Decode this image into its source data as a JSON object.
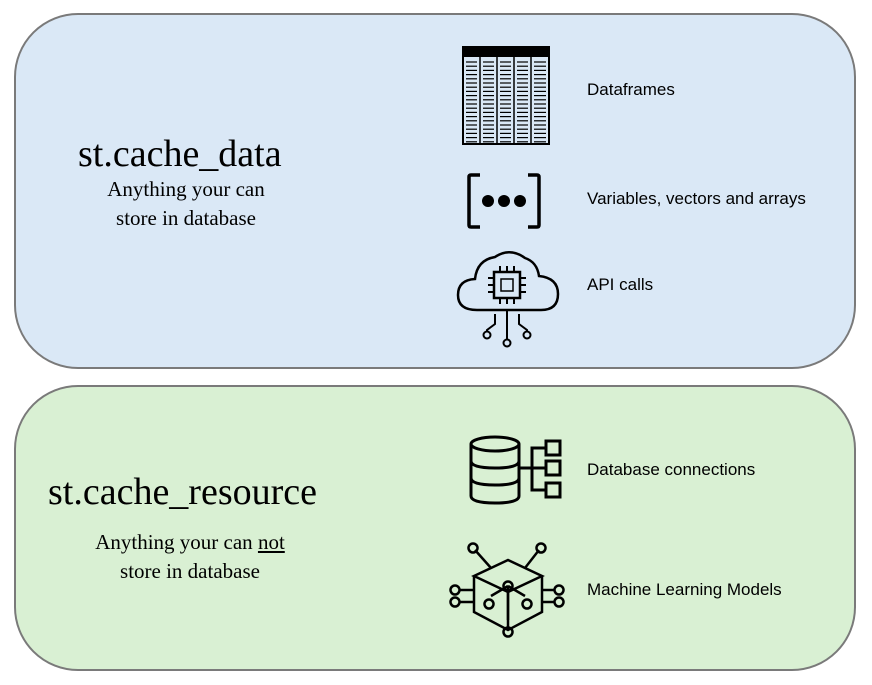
{
  "data_panel": {
    "title": "st.cache_data",
    "subtitle_line1": "Anything your can",
    "subtitle_line2": "store in database",
    "items": [
      {
        "label": "Dataframes",
        "icon": "table-icon"
      },
      {
        "label": "Variables, vectors and arrays",
        "icon": "brackets-dots-icon"
      },
      {
        "label": "API calls",
        "icon": "cloud-chip-icon"
      }
    ],
    "color": "#dae8f6"
  },
  "resource_panel": {
    "title": "st.cache_resource",
    "subtitle_pre": "Anything your can ",
    "subtitle_not": "not",
    "subtitle_line2": "store in database",
    "items": [
      {
        "label": "Database connections",
        "icon": "database-network-icon"
      },
      {
        "label": "Machine Learning Models",
        "icon": "ml-cube-icon"
      }
    ],
    "color": "#d9f0d3"
  }
}
